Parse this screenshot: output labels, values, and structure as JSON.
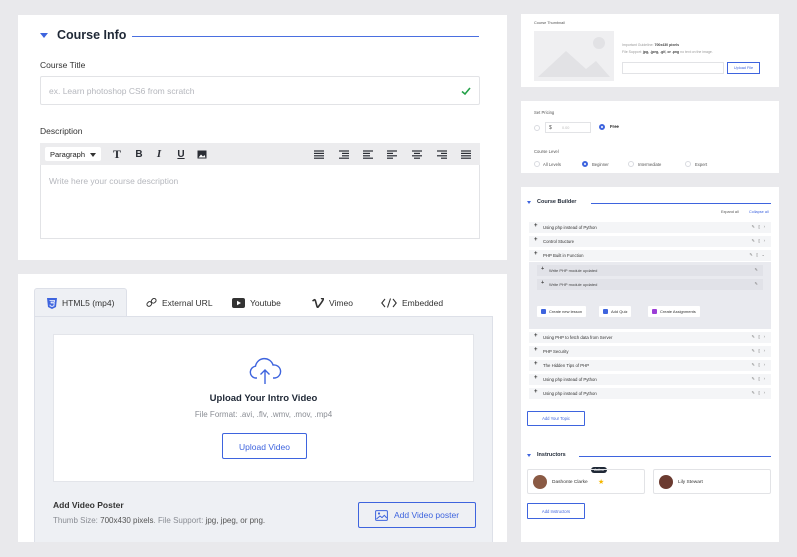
{
  "course_info": {
    "section_title": "Course Info",
    "title_label": "Course Title",
    "title_placeholder": "ex. Learn photoshop CS6 from scratch",
    "description_label": "Description",
    "paragraph_select": "Paragraph",
    "description_placeholder": "Write here your course description"
  },
  "video": {
    "tabs": [
      {
        "label": "HTML5 (mp4)"
      },
      {
        "label": "External URL"
      },
      {
        "label": "Youtube"
      },
      {
        "label": "Vimeo"
      },
      {
        "label": "Embedded"
      }
    ],
    "upload_title": "Upload Your Intro Video",
    "file_format": "File Format: .avi, .flv, .wmv, .mov, .mp4",
    "upload_button": "Upload Video",
    "poster_title": "Add Video Poster",
    "poster_size_prefix": "Thumb Size: ",
    "poster_size": "700x430 pixels",
    "poster_support_prefix": ". File Support: ",
    "poster_support": "jpg, jpeg, or png.",
    "poster_button": "Add Video poster"
  },
  "thumbnail": {
    "label": "Course Thumbnail",
    "size_prefix": "Important Guideline: ",
    "size": "700x430 pixels",
    "support_prefix": "File Support: ",
    "support": "jpg, .jpeg, .gif, or .png",
    "support_suffix": " no text on the image.",
    "button": "Upload File"
  },
  "pricing": {
    "label": "Set Pricing",
    "currency": "$",
    "price_placeholder": "0.00",
    "free_label": "Free",
    "level_label": "Course Level",
    "levels": [
      "All Levels",
      "Beginner",
      "Intermediate",
      "Expert"
    ],
    "selected_level": "Beginner"
  },
  "builder": {
    "title": "Course Builder",
    "expand_all": "Expand all",
    "collapse_all": "Collapse all",
    "topics_top": [
      "Using php instead of Python",
      "Control Stucture",
      "PHP Built in Function"
    ],
    "lessons": [
      "Write PHP module updated",
      "Write PHP module updated"
    ],
    "actions": {
      "lesson": "Create new lesson",
      "quiz": "Add Quiz",
      "assignment": "Create Assignments"
    },
    "topics_bottom": [
      "Using PHP to fetch data from Server",
      "PHP Security",
      "The Hidden Tips of PHP",
      "Using php instead of Python",
      "Using php instead of Python"
    ],
    "add_topic": "Add Your Topic",
    "instructors_title": "Instructors",
    "author_badge": "Author",
    "instructors": [
      "Dashonte Clarke",
      "Lily Stewart"
    ],
    "add_instructors": "Add Instructors"
  },
  "colors": {
    "accent": "#3e64de",
    "background": "#e9e9ec"
  }
}
